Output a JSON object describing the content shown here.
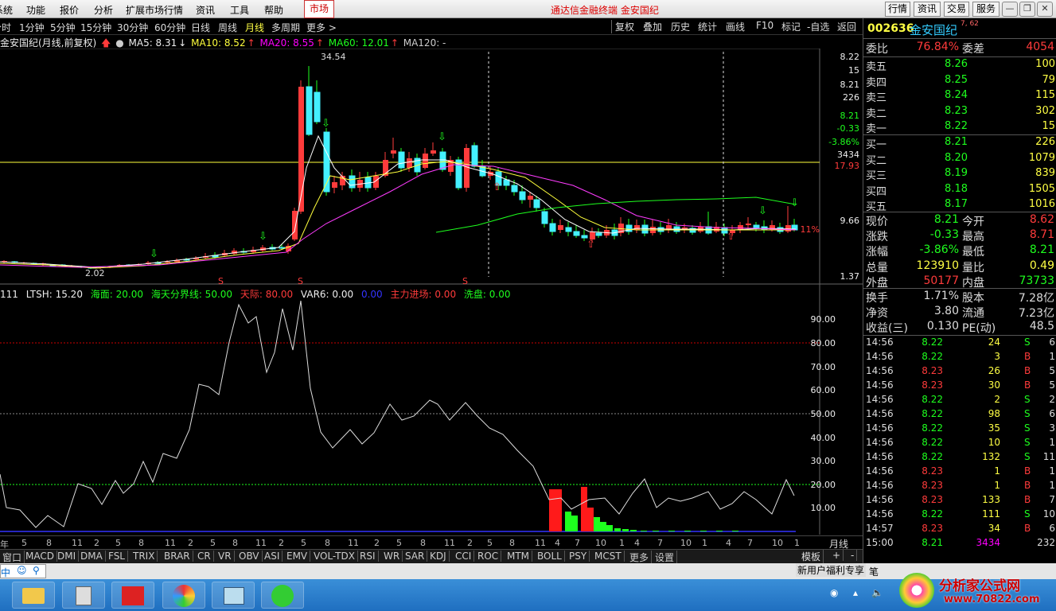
{
  "menu": [
    "系统",
    "功能",
    "报价",
    "分析",
    "扩展市场行情",
    "资讯",
    "工具",
    "帮助"
  ],
  "market_btn": "市场",
  "app_title": "通达信金融终端 金安国纪",
  "right_buttons": [
    "行情",
    "资讯",
    "交易",
    "服务"
  ],
  "periods": [
    "分时",
    "1分钟",
    "5分钟",
    "15分钟",
    "30分钟",
    "60分钟",
    "日线",
    "周线",
    "月线",
    "多周期",
    "更多 >"
  ],
  "tools": [
    "复权",
    "叠加",
    "历史",
    "统计",
    "画线",
    "F10",
    "标记",
    "-自选",
    "返回"
  ],
  "ma_line": {
    "title": "金安国纪(月线,前复权)",
    "ma5": "MA5: 8.31",
    "ma10": "MA10: 8.52",
    "ma20": "MA20: 8.55",
    "ma60": "MA60: 12.01",
    "ma120": "MA120: -"
  },
  "main_axis": {
    "y1": "8.22",
    "y2": "15",
    "y3": "8.21",
    "y4": "226",
    "y5": "8.21",
    "y6": "-0.33",
    "y7": "-3.86%",
    "y8": "3434",
    "y9": "17.93",
    "y10": "9.66",
    "y11": "11%",
    "y12": "1.37"
  },
  "main_labels": {
    "high": "34.54",
    "low": "2.02"
  },
  "ind_line": {
    "name": "111",
    "ltsh": "LTSH: 15.20",
    "haimian": "海面: 20.00",
    "fenjie": "海天分界线: 50.00",
    "tianji": "天际: 80.00",
    "var6": "VAR6: 0.00",
    "zero": "0.00",
    "zhuli": "主力进场: 0.00",
    "xipan": "洗盘: 0.00"
  },
  "ind_axis": [
    "90.00",
    "80.00",
    "70.00",
    "60.00",
    "50.00",
    "40.00",
    "30.00",
    "20.00",
    "10.00"
  ],
  "xaxis": [
    "年",
    "5",
    "8",
    "11",
    "2",
    "5",
    "8",
    "11",
    "2",
    "5",
    "8",
    "11",
    "2",
    "5",
    "8",
    "11",
    "2",
    "5",
    "8",
    "11",
    "2",
    "5",
    "8",
    "11",
    "4",
    "7",
    "10",
    "1",
    "4",
    "7",
    "10",
    "1",
    "4",
    "7",
    "10",
    "1",
    "4",
    "7",
    "10",
    "1"
  ],
  "period_lbl": "月线",
  "tabs": [
    "窗口",
    "MACD",
    "DMI",
    "DMA",
    "FSL",
    "TRIX",
    "BRAR",
    "CR",
    "VR",
    "OBV",
    "ASI",
    "EMV",
    "VOL-TDX",
    "RSI",
    "WR",
    "SAR",
    "KDJ",
    "CCI",
    "ROC",
    "MTM",
    "BOLL",
    "PSY",
    "MCST",
    "更多",
    "设置"
  ],
  "tabs_right": {
    "moban": "模板",
    "plus": "+",
    "minus": "-"
  },
  "promo": "新用户福利专享",
  "search": "中",
  "stock": {
    "code": "002636",
    "name": "金安国纪",
    "tag": "7, 62"
  },
  "weibi": {
    "l": "委比",
    "v": "76.84%",
    "l2": "委差",
    "v2": "4054"
  },
  "asks": [
    {
      "l": "卖五",
      "p": "8.26",
      "q": "100"
    },
    {
      "l": "卖四",
      "p": "8.25",
      "q": "79"
    },
    {
      "l": "卖三",
      "p": "8.24",
      "q": "115"
    },
    {
      "l": "卖二",
      "p": "8.23",
      "q": "302"
    },
    {
      "l": "卖一",
      "p": "8.22",
      "q": "15"
    }
  ],
  "bids": [
    {
      "l": "买一",
      "p": "8.21",
      "q": "226"
    },
    {
      "l": "买二",
      "p": "8.20",
      "q": "1079"
    },
    {
      "l": "买三",
      "p": "8.19",
      "q": "839"
    },
    {
      "l": "买四",
      "p": "8.18",
      "q": "1505"
    },
    {
      "l": "买五",
      "p": "8.17",
      "q": "1016"
    }
  ],
  "quote": [
    {
      "l": "现价",
      "v": "8.21",
      "l2": "今开",
      "v2": "8.62"
    },
    {
      "l": "涨跌",
      "v": "-0.33",
      "l2": "最高",
      "v2": "8.71"
    },
    {
      "l": "涨幅",
      "v": "-3.86%",
      "l2": "最低",
      "v2": "8.21"
    },
    {
      "l": "总量",
      "v": "123910",
      "l2": "量比",
      "v2": "0.49"
    },
    {
      "l": "外盘",
      "v": "50177",
      "l2": "内盘",
      "v2": "73733"
    }
  ],
  "quote2": [
    {
      "l": "换手",
      "v": "1.71%",
      "l2": "股本",
      "v2": "7.28亿"
    },
    {
      "l": "净资",
      "v": "3.80",
      "l2": "流通",
      "v2": "7.23亿"
    },
    {
      "l": "收益(三)",
      "v": "0.130",
      "l2": "PE(动)",
      "v2": "48.5"
    }
  ],
  "ticks": [
    {
      "t": "14:56",
      "p": "8.22",
      "q": "24",
      "s": "S",
      "n": "6"
    },
    {
      "t": "14:56",
      "p": "8.22",
      "q": "3",
      "s": "B",
      "n": "1"
    },
    {
      "t": "14:56",
      "p": "8.23",
      "q": "26",
      "s": "B",
      "n": "5"
    },
    {
      "t": "14:56",
      "p": "8.23",
      "q": "30",
      "s": "B",
      "n": "5"
    },
    {
      "t": "14:56",
      "p": "8.22",
      "q": "2",
      "s": "S",
      "n": "2"
    },
    {
      "t": "14:56",
      "p": "8.22",
      "q": "98",
      "s": "S",
      "n": "6"
    },
    {
      "t": "14:56",
      "p": "8.22",
      "q": "35",
      "s": "S",
      "n": "3"
    },
    {
      "t": "14:56",
      "p": "8.22",
      "q": "10",
      "s": "S",
      "n": "1"
    },
    {
      "t": "14:56",
      "p": "8.22",
      "q": "132",
      "s": "S",
      "n": "11"
    },
    {
      "t": "14:56",
      "p": "8.23",
      "q": "1",
      "s": "B",
      "n": "1"
    },
    {
      "t": "14:56",
      "p": "8.23",
      "q": "1",
      "s": "B",
      "n": "1"
    },
    {
      "t": "14:56",
      "p": "8.23",
      "q": "133",
      "s": "B",
      "n": "7"
    },
    {
      "t": "14:56",
      "p": "8.22",
      "q": "111",
      "s": "S",
      "n": "10"
    },
    {
      "t": "14:57",
      "p": "8.23",
      "q": "34",
      "s": "B",
      "n": "6"
    },
    {
      "t": "15:00",
      "p": "8.21",
      "q": "3434",
      "s": "",
      "n": "232"
    }
  ],
  "watermark": {
    "title": "分析家公式网",
    "url": "www.70822.com"
  },
  "colors": {
    "up": "#ff3b3b",
    "down": "#1eff1e",
    "ma5": "#ffffff",
    "ma10": "#ffff3c",
    "ma20": "#ff3cff",
    "ma60": "#1eff1e",
    "price_line": "#ffff3c"
  }
}
